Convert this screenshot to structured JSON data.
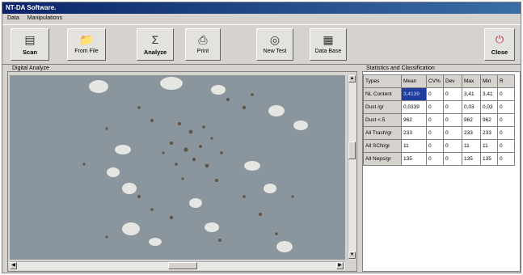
{
  "window": {
    "title": "NT-DA Software."
  },
  "menu": [
    "Data",
    "Manipulations"
  ],
  "toolbar": {
    "scan": "Scan",
    "from_file": "From File",
    "analyze": "Analyze",
    "print": "Print",
    "new_test": "New Test",
    "data_base": "Data Base",
    "close": "Close"
  },
  "icons": {
    "scan": "scanner-icon",
    "from_file": "folder-file-icon",
    "analyze": "sigma-icon",
    "print": "printer-icon",
    "new_test": "test-tube-icon",
    "data_base": "database-icon",
    "close": "power-icon"
  },
  "panels": {
    "image_label": "Digital Analyze",
    "stats_label": "Statistics and Classification"
  },
  "table": {
    "headers": [
      "Types",
      "Mean",
      "CV%",
      "Dev",
      "Max",
      "Min",
      "R"
    ],
    "rows": [
      [
        "NL Content",
        "3,4139",
        "0",
        "0",
        "3,41",
        "3,41",
        "0"
      ],
      [
        "Dust /gr",
        "0,0339",
        "0",
        "0",
        "0,03",
        "0,03",
        "0"
      ],
      [
        "Dust <.5",
        "962",
        "0",
        "0",
        "962",
        "962",
        "0"
      ],
      [
        "All Trash/gr",
        "233",
        "0",
        "0",
        "233",
        "233",
        "0"
      ],
      [
        "All SCN/gr",
        "11",
        "0",
        "0",
        "11",
        "11",
        "0"
      ],
      [
        "All Neps/gr",
        "135",
        "0",
        "0",
        "135",
        "135",
        "0"
      ]
    ]
  },
  "colors": {
    "titlebar": "#0a246a",
    "selected_cell": "#1f3fa0",
    "image_bg": "#8a949c"
  }
}
